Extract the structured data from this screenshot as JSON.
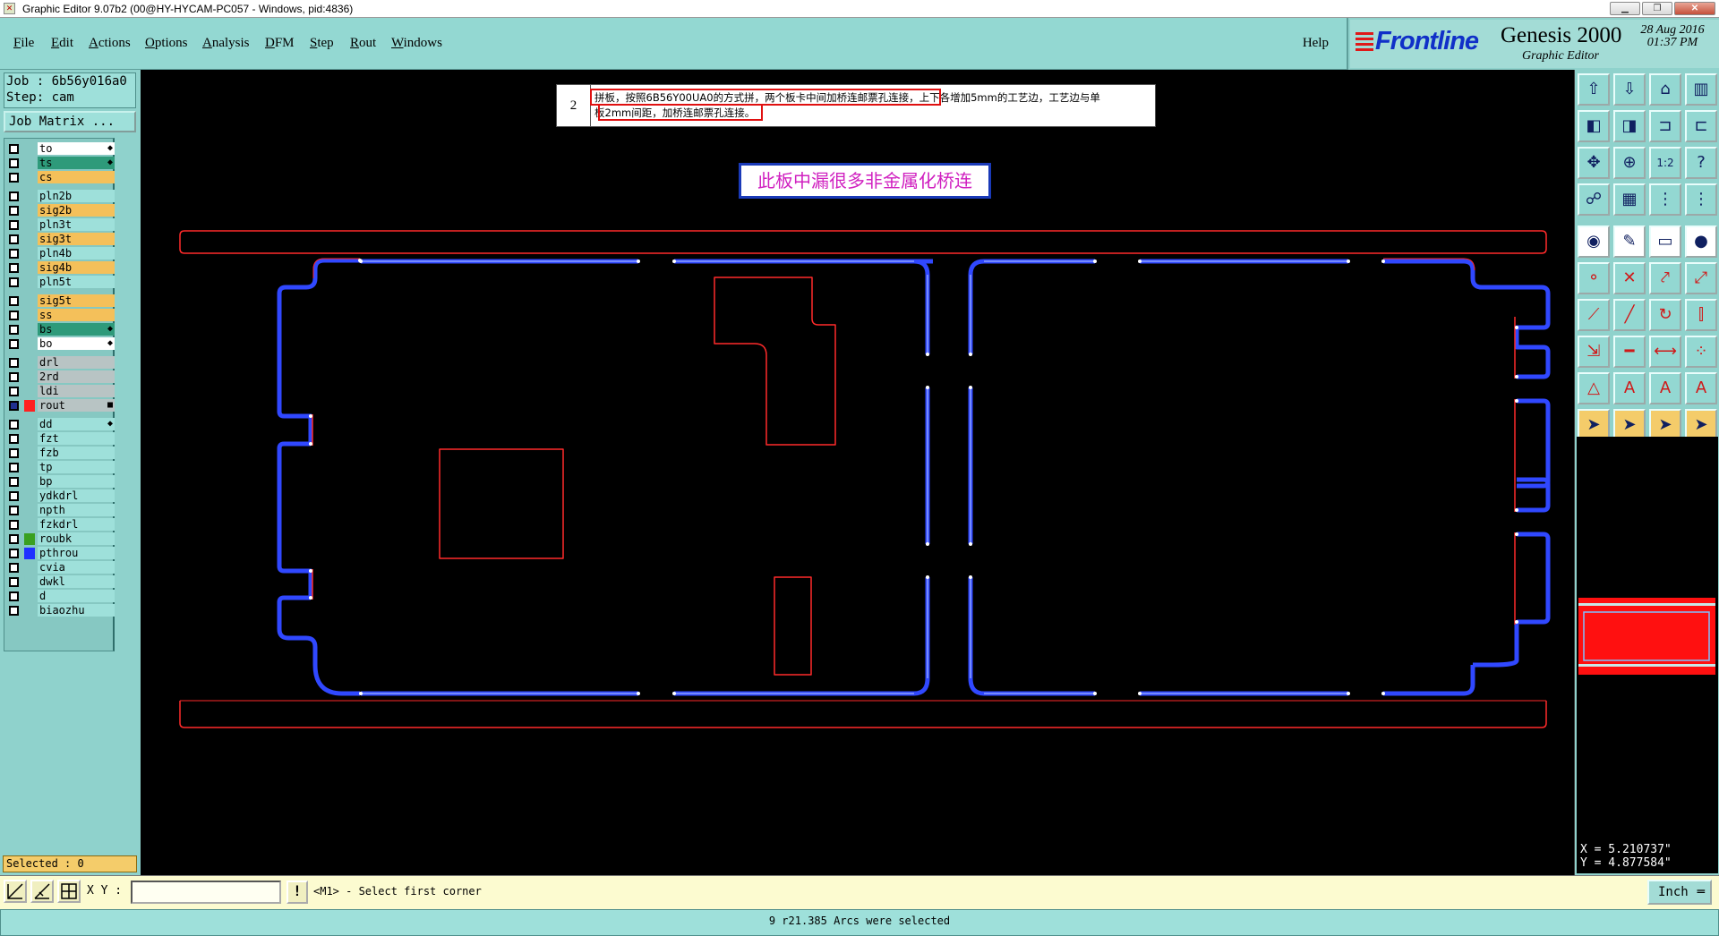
{
  "window": {
    "title": "Graphic Editor 9.07b2 (00@HY-HYCAM-PC057 - Windows, pid:4836)",
    "min_icon": "minimize-icon",
    "max_icon": "maximize-icon",
    "close_icon": "close-icon"
  },
  "menu": [
    "File",
    "Edit",
    "Actions",
    "Options",
    "Analysis",
    "DFM",
    "Step",
    "Rout",
    "Windows"
  ],
  "help": "Help",
  "logo": {
    "brand": "Frontline",
    "product": "Genesis 2000",
    "subtitle": "Graphic Editor",
    "date": "28 Aug 2016",
    "time": "01:37 PM"
  },
  "job": {
    "job_line": "Job : 6b56y016a0",
    "step_line": "Step: cam",
    "matrix_button": "Job Matrix ..."
  },
  "layers": [
    {
      "name": "to",
      "color": "#ffffff",
      "swatch": "",
      "mark": "◆",
      "checked": false
    },
    {
      "name": "ts",
      "color": "#2e9a7a",
      "swatch": "",
      "mark": "◆",
      "checked": false
    },
    {
      "name": "cs",
      "color": "#f4c05a",
      "swatch": "",
      "mark": "",
      "checked": false
    },
    {
      "name": "pln2b",
      "color": "#9ee0da",
      "swatch": "",
      "mark": "",
      "checked": false
    },
    {
      "name": "sig2b",
      "color": "#f4c05a",
      "swatch": "",
      "mark": "",
      "checked": false
    },
    {
      "name": "pln3t",
      "color": "#9ee0da",
      "swatch": "",
      "mark": "",
      "checked": false
    },
    {
      "name": "sig3t",
      "color": "#f4c05a",
      "swatch": "",
      "mark": "",
      "checked": false
    },
    {
      "name": "pln4b",
      "color": "#9ee0da",
      "swatch": "",
      "mark": "",
      "checked": false
    },
    {
      "name": "sig4b",
      "color": "#f4c05a",
      "swatch": "",
      "mark": "",
      "checked": false
    },
    {
      "name": "pln5t",
      "color": "#9ee0da",
      "swatch": "",
      "mark": "",
      "checked": false
    },
    {
      "name": "sig5t",
      "color": "#f4c05a",
      "swatch": "",
      "mark": "",
      "checked": false
    },
    {
      "name": "ss",
      "color": "#f4c05a",
      "swatch": "",
      "mark": "",
      "checked": false
    },
    {
      "name": "bs",
      "color": "#2e9a7a",
      "swatch": "",
      "mark": "◆",
      "checked": false
    },
    {
      "name": "bo",
      "color": "#ffffff",
      "swatch": "",
      "mark": "◆",
      "checked": false
    },
    {
      "name": "drl",
      "color": "#b8c4c4",
      "swatch": "",
      "mark": "",
      "checked": false
    },
    {
      "name": "2rd",
      "color": "#b8c4c4",
      "swatch": "",
      "mark": "",
      "checked": false
    },
    {
      "name": "ldi",
      "color": "#b8c4c4",
      "swatch": "",
      "mark": "",
      "checked": false
    },
    {
      "name": "rout",
      "color": "#b8c4c4",
      "swatch": "#ff2020",
      "mark": "■",
      "checked": true
    },
    {
      "name": "dd",
      "color": "#9ee0da",
      "swatch": "",
      "mark": "◆",
      "checked": false
    },
    {
      "name": "fzt",
      "color": "#9ee0da",
      "swatch": "",
      "mark": "",
      "checked": false
    },
    {
      "name": "fzb",
      "color": "#9ee0da",
      "swatch": "",
      "mark": "",
      "checked": false
    },
    {
      "name": "tp",
      "color": "#9ee0da",
      "swatch": "",
      "mark": "",
      "checked": false
    },
    {
      "name": "bp",
      "color": "#9ee0da",
      "swatch": "",
      "mark": "",
      "checked": false
    },
    {
      "name": "ydkdrl",
      "color": "#9ee0da",
      "swatch": "",
      "mark": "",
      "checked": false
    },
    {
      "name": "npth",
      "color": "#9ee0da",
      "swatch": "",
      "mark": "",
      "checked": false
    },
    {
      "name": "fzkdrl",
      "color": "#9ee0da",
      "swatch": "",
      "mark": "",
      "checked": false
    },
    {
      "name": "roubk",
      "color": "#9ee0da",
      "swatch": "#3aa020",
      "mark": "",
      "checked": false
    },
    {
      "name": "pthrou",
      "color": "#9ee0da",
      "swatch": "#2030ff",
      "mark": "",
      "checked": false
    },
    {
      "name": "cvia",
      "color": "#9ee0da",
      "swatch": "",
      "mark": "",
      "checked": false
    },
    {
      "name": "dwkl",
      "color": "#9ee0da",
      "swatch": "",
      "mark": "",
      "checked": false
    },
    {
      "name": "d",
      "color": "#9ee0da",
      "swatch": "",
      "mark": "",
      "checked": false
    },
    {
      "name": "biaozhu",
      "color": "#9ee0da",
      "swatch": "",
      "mark": "",
      "checked": false
    }
  ],
  "selected": "Selected : 0",
  "note": {
    "number": "2",
    "line1": "拼板，按照6B56Y00UA0的方式拼，两个板卡中间加桥连邮票孔连接，上下各增加5mm的工艺边，工艺边与单",
    "line2": "板2mm间距，加桥连邮票孔连接。"
  },
  "callout": "此板中漏很多非金属化桥连",
  "coords": {
    "x": "X = 5.210737\"",
    "y": "Y = 4.877584\""
  },
  "command": {
    "xy_label": "X Y :",
    "xy_value": "",
    "prompt": "<M1> - Select first corner",
    "unit": "Inch",
    "excl": "!"
  },
  "status": "9 r21.385 Arcs were selected",
  "tools": [
    "step-up-icon",
    "step-down-icon",
    "home-icon",
    "panes-icon",
    "zoom-left-icon",
    "zoom-right-icon",
    "fit-icon",
    "split-icon",
    "fit-screen-icon",
    "center-icon",
    "ratio-icon",
    "help-icon",
    "snapshot-icon",
    "grid-icon",
    "layer-up-icon",
    "layer-down-icon",
    "camera-icon",
    "draw-icon",
    "ruler-icon",
    "dot-icon",
    "node-icon",
    "cross-icon",
    "connect-icon",
    "link-icon",
    "line-icon",
    "slash-icon",
    "arc-icon",
    "split-line-icon",
    "move-icon",
    "minus-icon",
    "measure-icon",
    "group-icon",
    "triangle-icon",
    "text-a-icon",
    "text-a2-icon",
    "text-a3-icon",
    "pointer-icon",
    "pointer2-icon",
    "pointer3-icon",
    "pointer4-icon"
  ]
}
